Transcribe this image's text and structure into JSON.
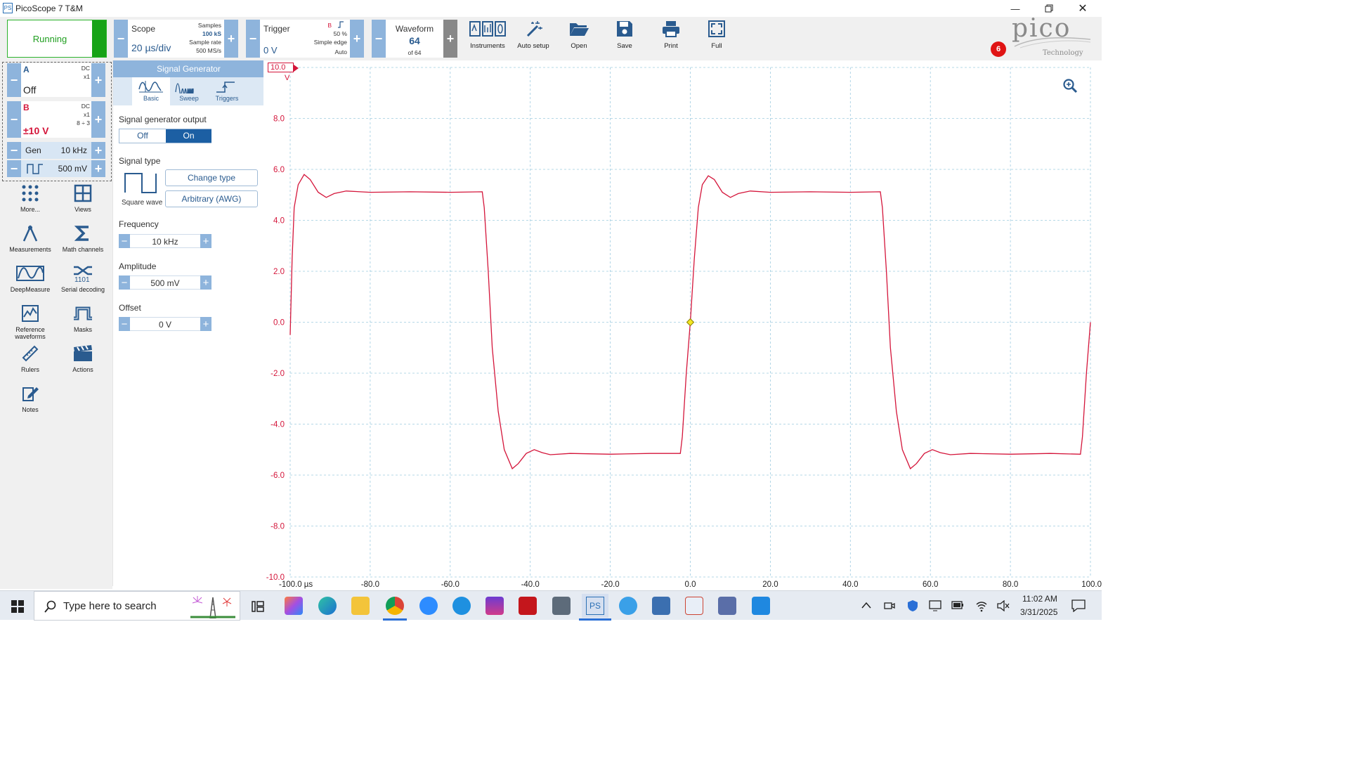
{
  "window": {
    "title": "PicoScope 7 T&M"
  },
  "toolbar": {
    "run_label": "Running",
    "scope": {
      "title": "Scope",
      "timebase": "20 µs/div",
      "samples_label": "Samples",
      "samples_value": "100 kS",
      "rate_label": "Sample rate",
      "rate_value": "500 MS/s"
    },
    "trigger": {
      "title": "Trigger",
      "level": "0 V",
      "source": "B",
      "percent": "50 %",
      "type": "Simple edge",
      "mode": "Auto"
    },
    "waveform": {
      "title": "Waveform",
      "number": "64",
      "of": "of 64"
    },
    "tools": [
      {
        "label": "Instruments",
        "icon": "instruments-icon"
      },
      {
        "label": "Auto setup",
        "icon": "auto-setup-wand-icon"
      },
      {
        "label": "Open",
        "icon": "folder-open-icon"
      },
      {
        "label": "Save",
        "icon": "floppy-disk-icon"
      },
      {
        "label": "Print",
        "icon": "printer-icon"
      },
      {
        "label": "Full",
        "icon": "fullscreen-icon"
      }
    ],
    "notification_count": "6",
    "logo": {
      "text": "pico",
      "subtext": "Technology"
    }
  },
  "channels": {
    "a": {
      "name": "A",
      "coupling": "DC",
      "probe": "x1",
      "range": "Off"
    },
    "b": {
      "name": "B",
      "coupling": "DC",
      "probe": "x1",
      "extra": "8 ÷ 3",
      "range": "±10 V"
    },
    "gen": {
      "label": "Gen",
      "frequency": "10 kHz",
      "amplitude": "500 mV"
    }
  },
  "left_tools": [
    {
      "label": "More...",
      "icon": "more-dots-icon"
    },
    {
      "label": "Views",
      "icon": "views-grid-icon"
    },
    {
      "label": "Measurements",
      "icon": "measurements-icon"
    },
    {
      "label": "Math channels",
      "icon": "sigma-icon"
    },
    {
      "label": "DeepMeasure",
      "icon": "deepmeasure-icon"
    },
    {
      "label": "Serial decoding",
      "icon": "serial-decoding-icon"
    },
    {
      "label": "Reference waveforms",
      "icon": "reference-waveform-icon"
    },
    {
      "label": "Masks",
      "icon": "masks-icon"
    },
    {
      "label": "Rulers",
      "icon": "ruler-icon"
    },
    {
      "label": "Actions",
      "icon": "clapper-icon"
    },
    {
      "label": "Notes",
      "icon": "notes-icon"
    }
  ],
  "siggen": {
    "title": "Signal Generator",
    "tabs": [
      "Basic",
      "Sweep",
      "Triggers"
    ],
    "output_label": "Signal generator output",
    "output_off": "Off",
    "output_on": "On",
    "type_label": "Signal type",
    "type_name": "Square wave",
    "change_type": "Change type",
    "arbitrary": "Arbitrary (AWG)",
    "frequency_label": "Frequency",
    "frequency_value": "10 kHz",
    "amplitude_label": "Amplitude",
    "amplitude_value": "500 mV",
    "offset_label": "Offset",
    "offset_value": "0 V"
  },
  "plot": {
    "y_top_badge": "10.0",
    "y_unit": "V",
    "y_ticks": [
      "8.0",
      "6.0",
      "4.0",
      "2.0",
      "0.0",
      "-2.0",
      "-4.0",
      "-6.0",
      "-8.0",
      "-10.0"
    ],
    "x_ticks": [
      "-100.0 µs",
      "-80.0",
      "-60.0",
      "-40.0",
      "-20.0",
      "0.0",
      "20.0",
      "40.0",
      "60.0",
      "80.0",
      "100.0"
    ],
    "trace_color": "#d4153a"
  },
  "chart_data": {
    "type": "line",
    "title": "",
    "xlabel": "µs",
    "ylabel": "V",
    "xlim": [
      -100,
      100
    ],
    "ylim": [
      -10,
      10
    ],
    "grid": true,
    "series": [
      {
        "color": "#d4153a",
        "points": [
          [
            -100,
            -0.5
          ],
          [
            -99.5,
            2.5
          ],
          [
            -99,
            4.5
          ],
          [
            -98,
            5.4
          ],
          [
            -96.5,
            5.8
          ],
          [
            -95,
            5.6
          ],
          [
            -93,
            5.1
          ],
          [
            -91,
            4.9
          ],
          [
            -89,
            5.05
          ],
          [
            -86,
            5.15
          ],
          [
            -80,
            5.1
          ],
          [
            -70,
            5.12
          ],
          [
            -60,
            5.1
          ],
          [
            -52,
            5.12
          ],
          [
            -51.5,
            4.5
          ],
          [
            -50.5,
            2.0
          ],
          [
            -49.5,
            -1.0
          ],
          [
            -48,
            -3.5
          ],
          [
            -46.5,
            -5.0
          ],
          [
            -44.5,
            -5.75
          ],
          [
            -43,
            -5.55
          ],
          [
            -41,
            -5.15
          ],
          [
            -39,
            -5.0
          ],
          [
            -37,
            -5.12
          ],
          [
            -35,
            -5.2
          ],
          [
            -30,
            -5.15
          ],
          [
            -20,
            -5.18
          ],
          [
            -10,
            -5.15
          ],
          [
            -2.5,
            -5.15
          ],
          [
            -2,
            -4.5
          ],
          [
            -1,
            -2.0
          ],
          [
            0,
            0.0
          ],
          [
            1,
            2.5
          ],
          [
            2,
            4.5
          ],
          [
            3,
            5.4
          ],
          [
            4.5,
            5.75
          ],
          [
            6,
            5.6
          ],
          [
            8,
            5.1
          ],
          [
            10,
            4.9
          ],
          [
            12,
            5.05
          ],
          [
            15,
            5.15
          ],
          [
            20,
            5.1
          ],
          [
            30,
            5.12
          ],
          [
            40,
            5.1
          ],
          [
            47.5,
            5.12
          ],
          [
            48,
            4.5
          ],
          [
            49,
            2.0
          ],
          [
            50,
            -1.0
          ],
          [
            51.5,
            -3.5
          ],
          [
            53,
            -5.0
          ],
          [
            55,
            -5.75
          ],
          [
            56.5,
            -5.55
          ],
          [
            58.5,
            -5.15
          ],
          [
            60.5,
            -5.0
          ],
          [
            62.5,
            -5.12
          ],
          [
            65,
            -5.2
          ],
          [
            70,
            -5.15
          ],
          [
            80,
            -5.18
          ],
          [
            90,
            -5.15
          ],
          [
            97.5,
            -5.18
          ],
          [
            98,
            -4.5
          ],
          [
            99,
            -2.0
          ],
          [
            100,
            0.0
          ]
        ]
      }
    ],
    "trigger_marker": [
      0,
      0
    ]
  },
  "taskbar": {
    "search_placeholder": "Type here to search",
    "time": "11:02 AM",
    "date": "3/31/2025"
  }
}
